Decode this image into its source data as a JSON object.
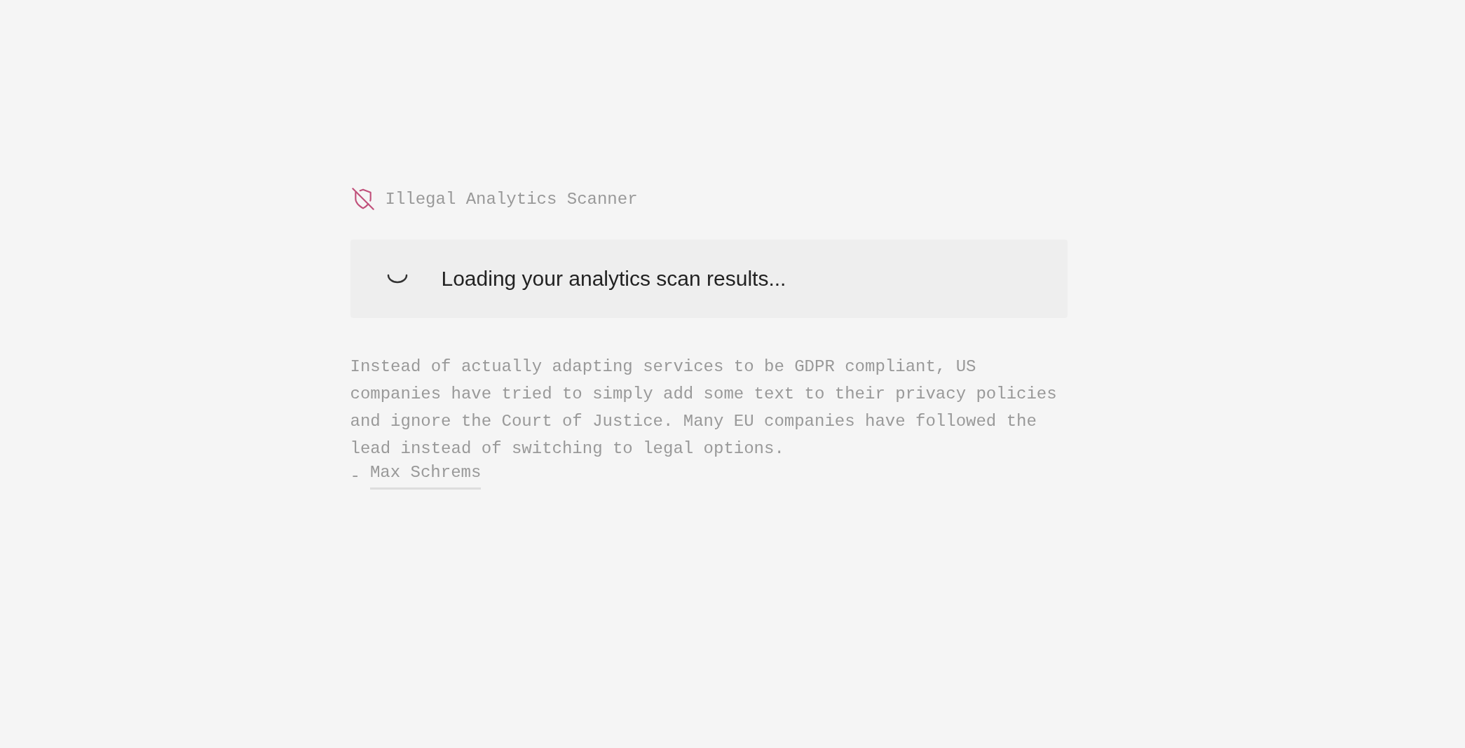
{
  "header": {
    "title": "Illegal Analytics Scanner"
  },
  "loading": {
    "message": "Loading your analytics scan results..."
  },
  "quote": {
    "text": "Instead of actually adapting services to be GDPR compliant, US companies have tried to simply add some text to their privacy policies and ignore the Court of Justice. Many EU companies have followed the lead instead of switching to legal options.",
    "dash": "-",
    "author": "Max Schrems"
  }
}
